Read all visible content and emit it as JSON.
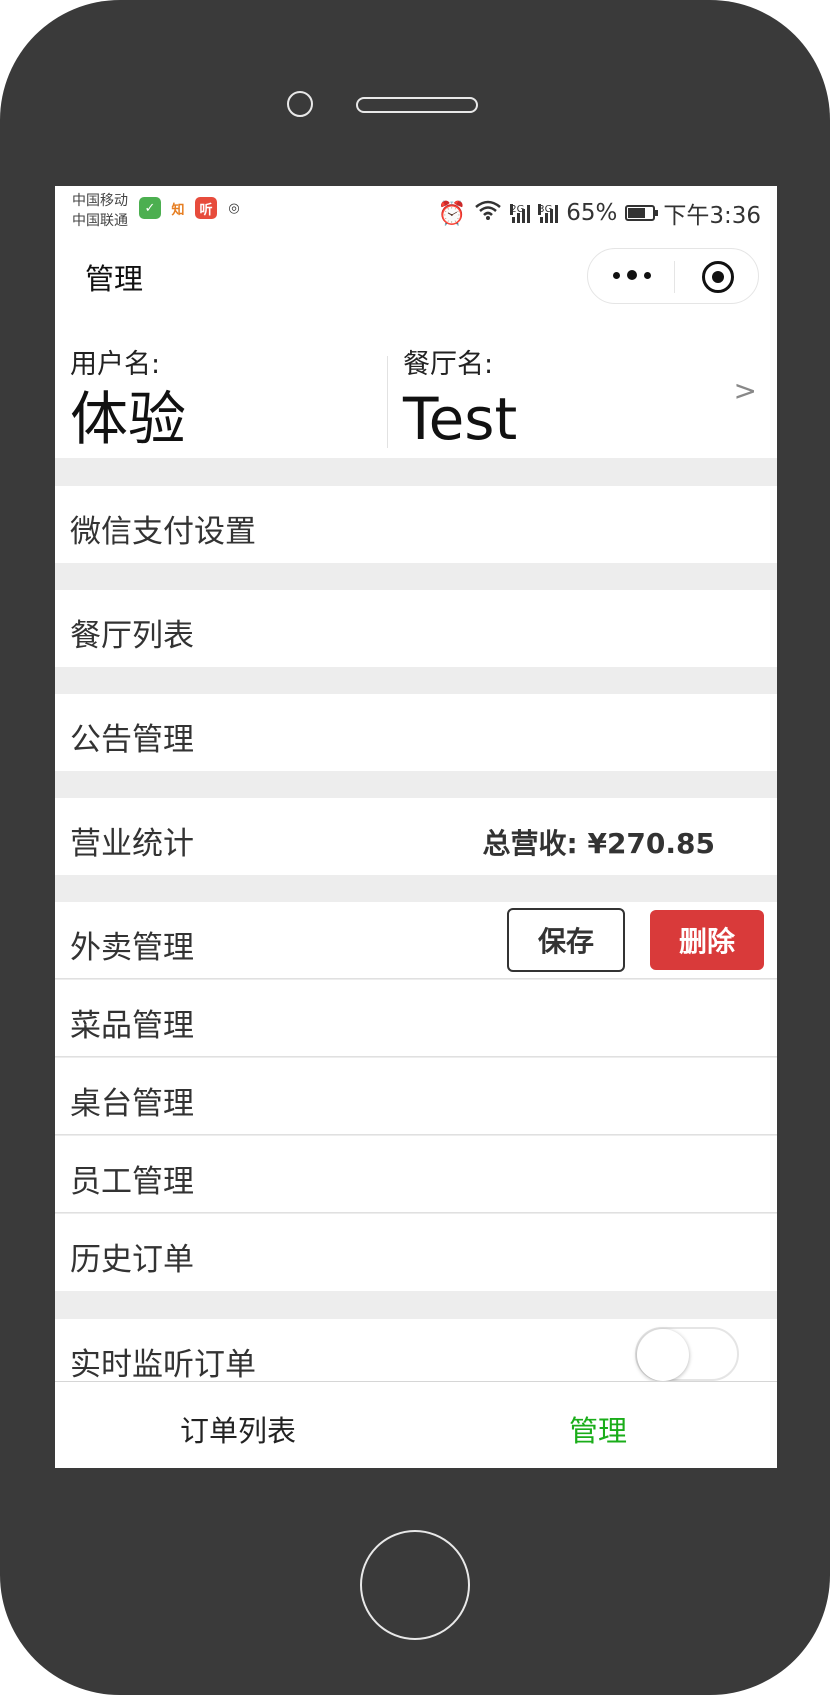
{
  "status_bar": {
    "carrier1": "中国移动",
    "carrier2": "中国联通",
    "app_icons": [
      "shield-check-icon",
      "zhihu-icon",
      "listen-app-icon",
      "alarm-bell-icon"
    ],
    "signal1": "2G",
    "signal2": "3G",
    "battery": "65%",
    "time": "下午3:36"
  },
  "nav": {
    "title": "管理"
  },
  "profile": {
    "user_label": "用户名:",
    "user_value": "体验",
    "restaurant_label": "餐厅名:",
    "restaurant_value": "Test",
    "chevron": ">"
  },
  "menu": {
    "wechat_pay": "微信支付设置",
    "restaurant_list": "餐厅列表",
    "announcement": "公告管理",
    "business_stats": "营业统计",
    "total_revenue": "总营收: ¥270.85",
    "takeout": "外卖管理",
    "save": "保存",
    "delete": "删除",
    "dishes": "菜品管理",
    "tables": "桌台管理",
    "staff": "员工管理",
    "history_orders": "历史订单",
    "live_monitor": "实时监听订单",
    "live_monitor_enabled": false
  },
  "tabs": {
    "orders": "订单列表",
    "manage": "管理",
    "active_color": "#1aad19"
  }
}
